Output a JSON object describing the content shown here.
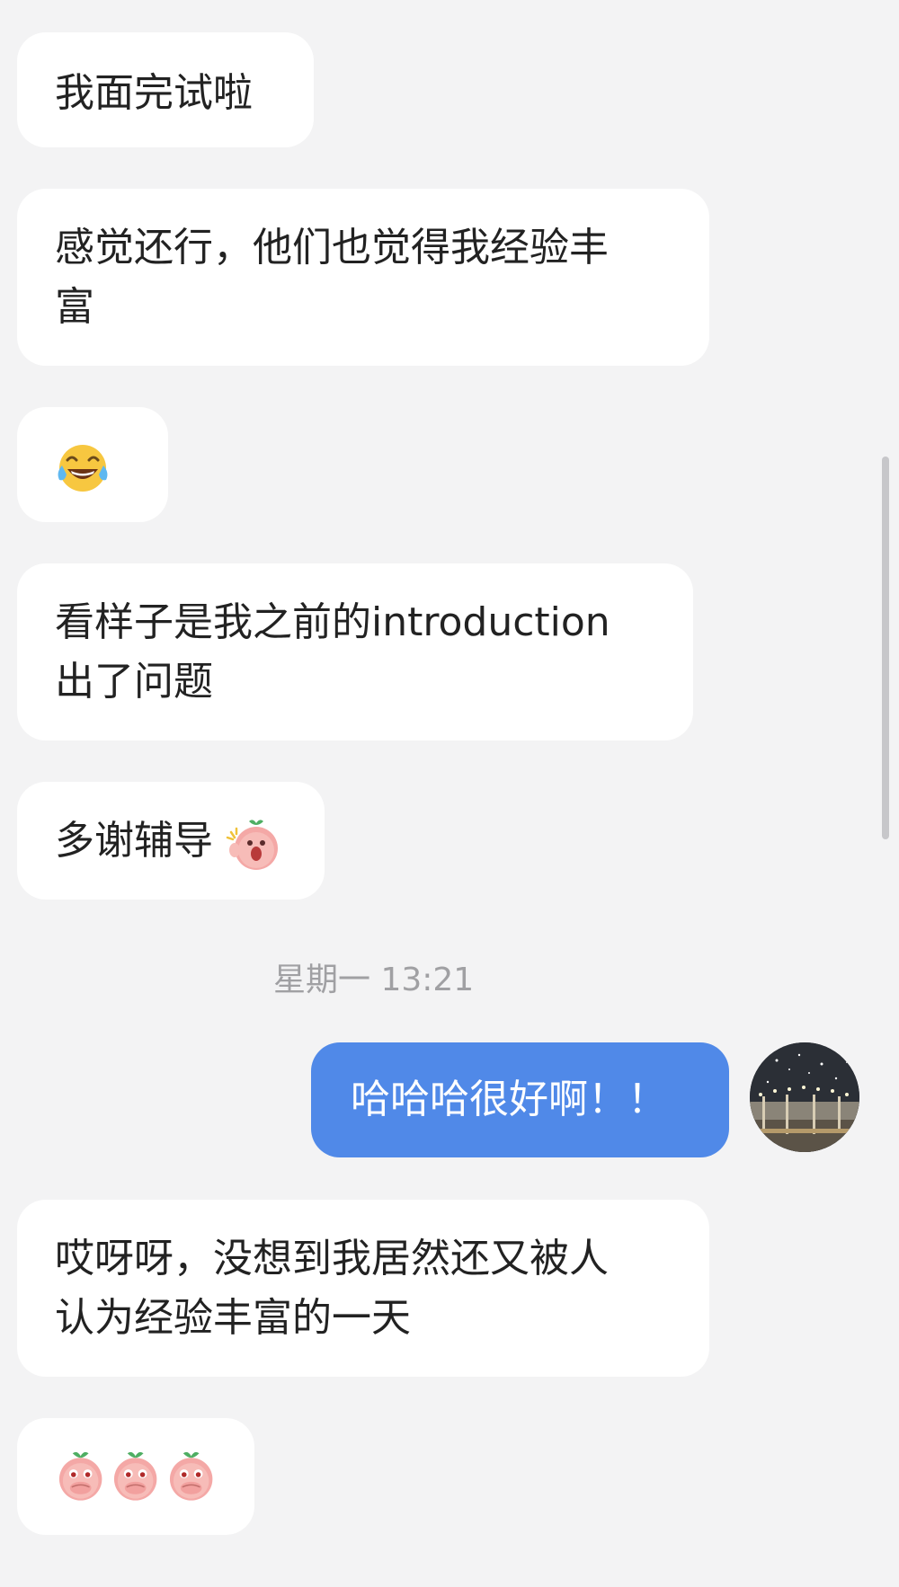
{
  "colors": {
    "background": "#f3f3f4",
    "incoming_bubble": "#ffffff",
    "outgoing_bubble": "#5089e8",
    "text": "#222222",
    "timestamp": "#a0a0a3"
  },
  "messages": [
    {
      "direction": "incoming",
      "text": "我面完试啦"
    },
    {
      "direction": "incoming",
      "text": "感觉还行，他们也觉得我经验丰富"
    },
    {
      "direction": "incoming",
      "emoji": "tears-of-joy-emoji"
    },
    {
      "direction": "incoming",
      "text": "看样子是我之前的introduction出了问题"
    },
    {
      "direction": "incoming",
      "text": "多谢辅导",
      "sticker": "peach-surprised-sticker"
    },
    {
      "direction": "outgoing",
      "text": "哈哈哈很好啊！！",
      "avatar": "user-avatar"
    },
    {
      "direction": "incoming",
      "text": "哎呀呀，没想到我居然还又被人认为经验丰富的一天"
    },
    {
      "direction": "incoming",
      "stickers": [
        "peach-covering-mouth-sticker",
        "peach-covering-mouth-sticker",
        "peach-covering-mouth-sticker"
      ]
    }
  ],
  "timestamp": "星期一 13:21",
  "text": {
    "m1": "我面完试啦",
    "m2_line1": "感觉还行，他们也觉得我经验丰",
    "m2_line2": "富",
    "m4_line1": "看样子是我之前的introduction",
    "m4_line2": "出了问题",
    "m5": "多谢辅导",
    "m6": "哈哈哈很好啊！！",
    "m7_line1": "哎呀呀，没想到我居然还又被人",
    "m7_line2": "认为经验丰富的一天"
  }
}
